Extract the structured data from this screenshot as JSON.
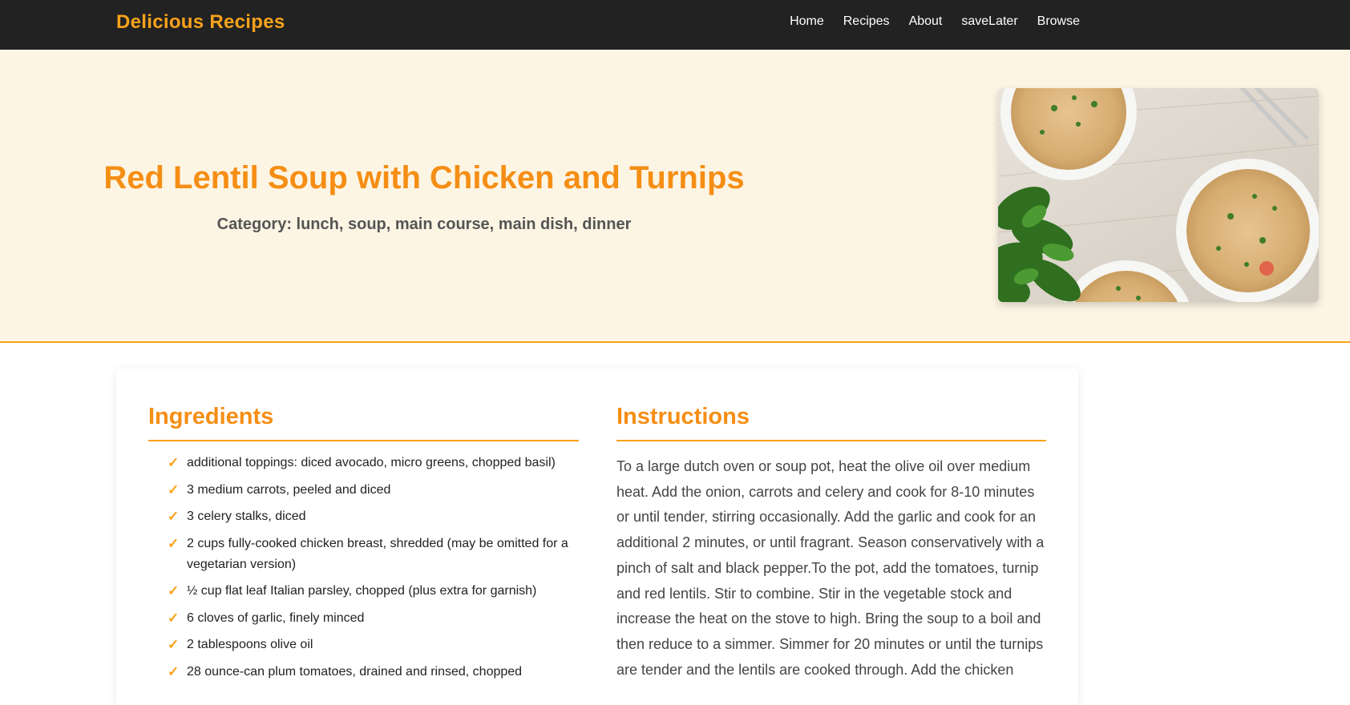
{
  "nav": {
    "brand": "Delicious Recipes",
    "links": [
      "Home",
      "Recipes",
      "About",
      "saveLater",
      "Browse"
    ]
  },
  "hero": {
    "title": "Red Lentil Soup with Chicken and Turnips",
    "category": "Category: lunch, soup, main course, main dish, dinner",
    "image_alt": "bowls of red lentil soup with chicken on a wooden table"
  },
  "ingredients": {
    "heading": "Ingredients",
    "items": [
      "additional toppings: diced avocado, micro greens, chopped basil)",
      "3 medium carrots, peeled and diced",
      "3 celery stalks, diced",
      "2 cups fully-cooked chicken breast, shredded (may be omitted for a vegetarian version)",
      "½ cup flat leaf Italian parsley, chopped (plus extra for garnish)",
      "6 cloves of garlic, finely minced",
      "2 tablespoons olive oil",
      "28 ounce-can plum tomatoes, drained and rinsed, chopped"
    ]
  },
  "instructions": {
    "heading": "Instructions",
    "text": "To a large dutch oven or soup pot, heat the olive oil over medium heat. Add the onion, carrots and celery and cook for 8-10 minutes or until tender, stirring occasionally. Add the garlic and cook for an additional 2 minutes, or until fragrant. Season conservatively with a pinch of salt and black pepper.To the pot, add the tomatoes, turnip and red lentils. Stir to combine. Stir in the vegetable stock and increase the heat on the stove to high. Bring the soup to a boil and then reduce to a simmer. Simmer for 20 minutes or until the turnips are tender and the lentils are cooked through. Add the chicken"
  },
  "colors": {
    "accent": "#f58e14",
    "navbar": "#222222",
    "hero_bg": "#fdf5e4"
  }
}
